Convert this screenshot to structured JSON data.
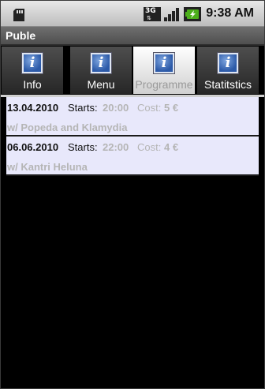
{
  "status_bar": {
    "time": "9:38 AM",
    "network_badge": "3G",
    "icons": [
      "sd-card-icon",
      "signal-icon",
      "battery-charging-icon"
    ]
  },
  "app": {
    "title": "Puble"
  },
  "tabs": [
    {
      "label": "Info",
      "icon": "info-icon",
      "selected": false
    },
    {
      "label": "Menu",
      "icon": "info-icon",
      "selected": false
    },
    {
      "label": "Programme",
      "icon": "info-icon",
      "selected": true
    },
    {
      "label": "Statitstics",
      "icon": "info-icon",
      "selected": false
    }
  ],
  "events": [
    {
      "date": "13.04.2010",
      "starts_label": "Starts:",
      "starts_value": "20:00",
      "cost_label": "Cost:",
      "cost_value": "5 €",
      "performers": "w/ Popeda and Klamydia"
    },
    {
      "date": "06.06.2010",
      "starts_label": "Starts:",
      "starts_value": "22:00",
      "cost_label": "Cost:",
      "cost_value": "4 €",
      "performers": "w/ Kantri Heluna"
    }
  ],
  "colors": {
    "list_background": "#e8e8fb",
    "muted_text": "#b5b5b5",
    "selected_tab": "#ffffff",
    "tab": "#3a3a3a"
  }
}
